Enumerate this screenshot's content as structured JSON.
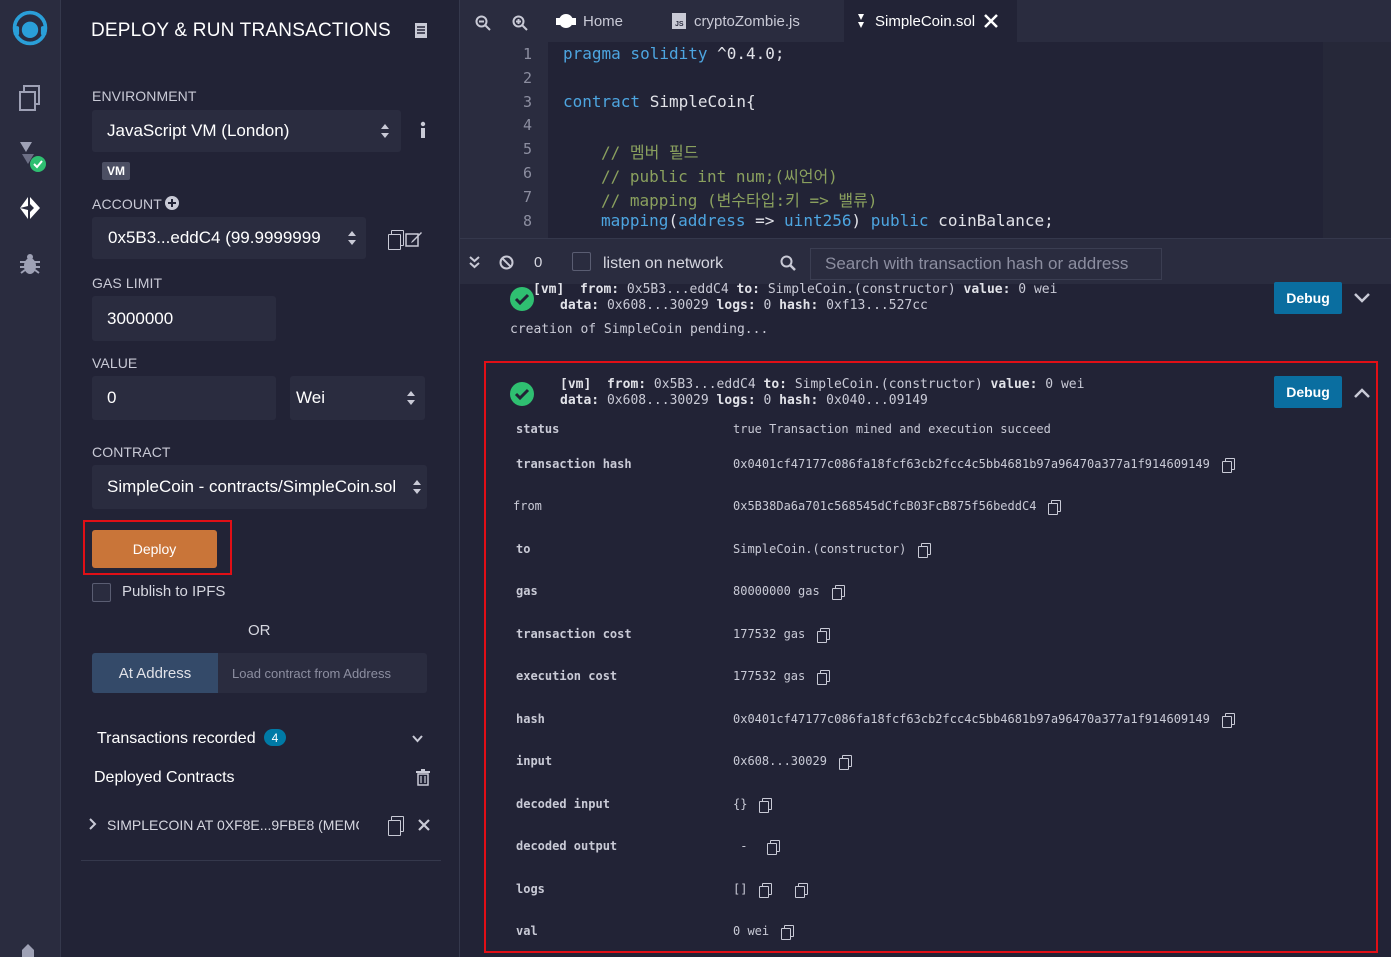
{
  "panel": {
    "title": "DEPLOY & RUN TRANSACTIONS",
    "environment_label": "ENVIRONMENT",
    "environment_value": "JavaScript VM (London)",
    "vm_badge": "VM",
    "account_label": "ACCOUNT",
    "account_value": "0x5B3...eddC4 (99.9999999",
    "gas_limit_label": "GAS LIMIT",
    "gas_limit_value": "3000000",
    "value_label": "VALUE",
    "value_value": "0",
    "value_unit": "Wei",
    "contract_label": "CONTRACT",
    "contract_value": "SimpleCoin - contracts/SimpleCoin.sol",
    "deploy_label": "Deploy",
    "publish_label": "Publish to IPFS",
    "or_label": "OR",
    "at_address_label": "At Address",
    "at_address_placeholder": "Load contract from Address",
    "transactions_recorded_label": "Transactions recorded",
    "transactions_recorded_count": "4",
    "deployed_contracts_label": "Deployed Contracts",
    "deployed_item": "SIMPLECOIN AT 0XF8E...9FBE8 (MEMOI"
  },
  "tabs": [
    {
      "label": "Home",
      "icon": "remix-home-icon"
    },
    {
      "label": "cryptoZombie.js",
      "icon": "js-file-icon"
    },
    {
      "label": "SimpleCoin.sol",
      "icon": "solidity-file-icon",
      "active": true
    }
  ],
  "code": {
    "line_numbers": [
      "1",
      "2",
      "3",
      "4",
      "5",
      "6",
      "7",
      "8"
    ],
    "l1a": "pragma solidity",
    "l1b": " ^0.4.0;",
    "l3a": "contract",
    "l3b": " SimpleCoin{",
    "l5": "// 멤버 필드",
    "l6": "// public int num;(씨언어)",
    "l7": "// mapping (변수타입:키 => 밸류)",
    "l8a": "mapping",
    "l8b": "(",
    "l8c": "address",
    "l8d": " => ",
    "l8e": "uint256",
    "l8f": ") ",
    "l8g": "public",
    "l8h": " coinBalance;"
  },
  "terminal": {
    "pending_count": "0",
    "listen_label": "listen on network",
    "search_placeholder": "Search with transaction hash or address",
    "tx1": {
      "line1_tag": "[vm]",
      "line1_from_k": "from:",
      "line1_from_v": " 0x5B3...eddC4 ",
      "line1_to_k": "to:",
      "line1_to_v": " SimpleCoin.(constructor) ",
      "line1_value_k": "value:",
      "line1_value_v": " 0 wei",
      "line2_data_k": "data:",
      "line2_data_v": " 0x608...30029 ",
      "line2_logs_k": "logs:",
      "line2_logs_v": " 0 ",
      "line2_hash_k": "hash:",
      "line2_hash_v": " 0xf13...527cc",
      "pending": "creation of SimpleCoin pending...",
      "debug_label": "Debug"
    },
    "tx2": {
      "line1_tag": "[vm]",
      "line1_from_k": "from:",
      "line1_from_v": " 0x5B3...eddC4 ",
      "line1_to_k": "to:",
      "line1_to_v": " SimpleCoin.(constructor) ",
      "line1_value_k": "value:",
      "line1_value_v": " 0 wei",
      "line2_data_k": "data:",
      "line2_data_v": " 0x608...30029 ",
      "line2_logs_k": "logs:",
      "line2_logs_v": " 0 ",
      "line2_hash_k": "hash:",
      "line2_hash_v": " 0x040...09149",
      "debug_label": "Debug",
      "rows": [
        {
          "key": "status",
          "value": "true Transaction mined and execution succeed"
        },
        {
          "key": "transaction hash",
          "value": "0x0401cf47177c086fa18fcf63cb2fcc4c5bb4681b97a96470a377a1f914609149"
        },
        {
          "key": "from",
          "value": "0x5B38Da6a701c568545dCfcB03FcB875f56beddC4"
        },
        {
          "key": "to",
          "value": "SimpleCoin.(constructor)"
        },
        {
          "key": "gas",
          "value": "80000000 gas"
        },
        {
          "key": "transaction cost",
          "value": "177532 gas"
        },
        {
          "key": "execution cost",
          "value": "177532 gas"
        },
        {
          "key": "hash",
          "value": "0x0401cf47177c086fa18fcf63cb2fcc4c5bb4681b97a96470a377a1f914609149"
        },
        {
          "key": "input",
          "value": "0x608...30029"
        },
        {
          "key": "decoded input",
          "value": "{}"
        },
        {
          "key": "decoded output",
          "value": " - "
        },
        {
          "key": "logs",
          "value": "[]"
        },
        {
          "key": "val",
          "value": "0 wei"
        }
      ]
    }
  },
  "colors": {
    "accent": "#c97539",
    "debug": "#0a6ea0",
    "highlight": "#e10f16",
    "success": "#2fbf71"
  }
}
